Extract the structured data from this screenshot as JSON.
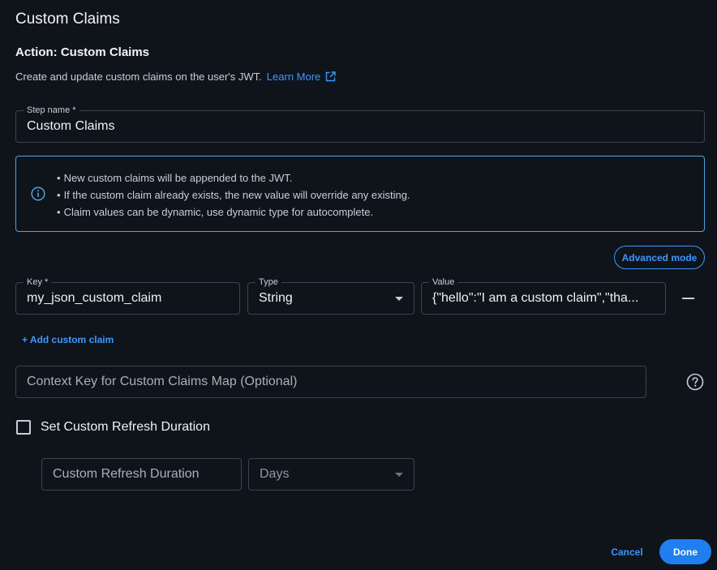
{
  "header": {
    "title": "Custom Claims",
    "action_title": "Action: Custom Claims",
    "description": "Create and update custom claims on the user's JWT.",
    "learn_more": "Learn More",
    "learn_more_icon": "external-link-icon"
  },
  "step_name": {
    "label": "Step name *",
    "value": "Custom Claims"
  },
  "info": {
    "icon": "info-icon",
    "items": [
      "New custom claims will be appended to the JWT.",
      "If the custom claim already exists, the new value will override any existing.",
      "Claim values can be dynamic, use dynamic type for autocomplete."
    ]
  },
  "advanced_mode_label": "Advanced mode",
  "claims": [
    {
      "key_label": "Key *",
      "key_value": "my_json_custom_claim",
      "type_label": "Type",
      "type_value": "String",
      "value_label": "Value",
      "value_value": "{\"hello\":\"I am a custom claim\",\"tha..."
    }
  ],
  "add_claim_label": "+ Add custom claim",
  "context_key": {
    "placeholder": "Context Key for Custom Claims Map (Optional)",
    "help_icon": "question-circle-icon"
  },
  "refresh": {
    "checkbox_label": "Set Custom Refresh Duration",
    "checked": false,
    "duration_placeholder": "Custom Refresh Duration",
    "unit_value": "Days"
  },
  "footer": {
    "cancel_label": "Cancel",
    "done_label": "Done"
  },
  "colors": {
    "background": "#0f141b",
    "accent": "#3e97ff",
    "primary_button": "#1f7ff0",
    "info_border": "#4fa3e0",
    "field_border": "#3a4350"
  }
}
